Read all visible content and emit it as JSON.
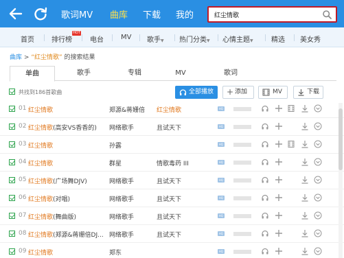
{
  "topbar": {
    "nav": [
      "歌词MV",
      "曲库",
      "下载",
      "我的"
    ],
    "active": "曲库",
    "search_value": "红尘情歌"
  },
  "categories": [
    "首页",
    "排行榜",
    "电台",
    "MV",
    "歌手",
    "热门分类",
    "心情主题",
    "精选",
    "美女秀"
  ],
  "hot_badge": "HOT",
  "breadcrumb": {
    "root": "曲库",
    "separator": ">",
    "keyword": "“红尘情歌”",
    "suffix": "的搜索结果"
  },
  "tabs": [
    "单曲",
    "歌手",
    "专辑",
    "MV",
    "歌词"
  ],
  "active_tab": "单曲",
  "toolbar": {
    "found_text": "共找到186首歌曲",
    "play_all": "全部播放",
    "add": "添加",
    "mv": "MV",
    "download": "下载"
  },
  "songs": [
    {
      "num": "01",
      "title": "红尘情歌",
      "subtitle": "",
      "artist": "郑源&蒋姗倍",
      "album": "红尘情歌",
      "album_highlight": true
    },
    {
      "num": "02",
      "title": "红尘情歌",
      "subtitle": "(高安VS香香的)",
      "artist": "网络歌手",
      "album": "且试天下",
      "album_highlight": false
    },
    {
      "num": "03",
      "title": "红尘情歌",
      "subtitle": "",
      "artist": "孙露",
      "album": "",
      "album_highlight": false
    },
    {
      "num": "04",
      "title": "红尘情歌",
      "subtitle": "",
      "artist": "群星",
      "album": "情歌毒药 III",
      "album_highlight": false
    },
    {
      "num": "05",
      "title": "红尘情歌",
      "subtitle": "(广场舞DJV)",
      "artist": "网络歌手",
      "album": "且试天下",
      "album_highlight": false
    },
    {
      "num": "06",
      "title": "红尘情歌",
      "subtitle": "(对唱)",
      "artist": "网络歌手",
      "album": "且试天下",
      "album_highlight": false
    },
    {
      "num": "07",
      "title": "红尘情歌",
      "subtitle": "(舞曲版)",
      "artist": "网络歌手",
      "album": "且试天下",
      "album_highlight": false
    },
    {
      "num": "08",
      "title": "红尘情歌",
      "subtitle": "(郑源&蒋姗倍DJ...",
      "artist": "网络歌手",
      "album": "且试天下",
      "album_highlight": false
    },
    {
      "num": "09",
      "title": "红尘情歌",
      "subtitle": "",
      "artist": "郑东",
      "album": "",
      "album_highlight": false
    }
  ],
  "hq_label": "HQ",
  "colors": {
    "brand_blue": "#2a8fe3",
    "accent_orange": "#e0771c",
    "active_nav": "#ffe14a",
    "search_border": "#c01a26"
  }
}
